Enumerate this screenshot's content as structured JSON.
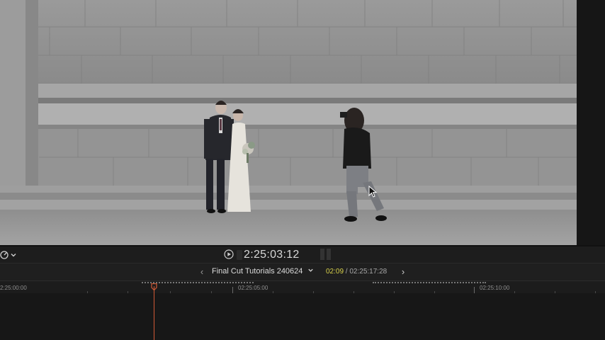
{
  "viewer": {
    "scene": "wedding-photoshoot-frame"
  },
  "transport": {
    "speed_icon": "speedometer-icon",
    "play_icon": "play-icon",
    "timecode": "2:25:03:12"
  },
  "timeline_header": {
    "back_symbol": "‹",
    "forward_symbol": "›",
    "project_name": "Final Cut Tutorials 240624",
    "chevron": "⌄",
    "duration_current": "02:09",
    "duration_separator": " / ",
    "duration_total": "02:25:17:28"
  },
  "ruler": {
    "labels": [
      "2:25:00:00",
      "02:25:05:00",
      "02:25:10:00"
    ]
  },
  "colors": {
    "playhead": "#d15a36",
    "duration_current": "#d7d04a",
    "background": "#1b1b1b"
  }
}
